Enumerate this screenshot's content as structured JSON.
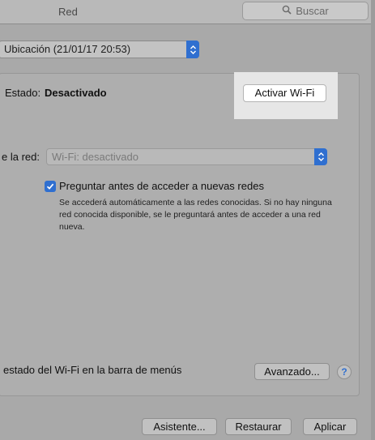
{
  "window": {
    "title": "Red"
  },
  "search": {
    "placeholder": "Buscar",
    "icon": "search-icon"
  },
  "location": {
    "value": "Ubicación (21/01/17 20:53)"
  },
  "status": {
    "label": "Estado:",
    "value": "Desactivado"
  },
  "wifi": {
    "activate_label": "Activar Wi-Fi"
  },
  "network": {
    "label": "e la red:",
    "value": "Wi-Fi: desactivado"
  },
  "ask": {
    "checked": true,
    "label": "Preguntar antes de acceder a nuevas redes",
    "help": "Se accederá automáticamente a las redes conocidas. Si no hay ninguna red conocida disponible, se le preguntará antes de acceder a una red nueva."
  },
  "menubar": {
    "label": "estado del Wi-Fi en la barra de menús"
  },
  "buttons": {
    "advanced": "Avanzado...",
    "help": "?",
    "assistant": "Asistente...",
    "revert": "Restaurar",
    "apply": "Aplicar"
  },
  "colors": {
    "accent": "#2f6fd0",
    "background": "#a9a9a9",
    "highlight": "#e6e6e6"
  }
}
